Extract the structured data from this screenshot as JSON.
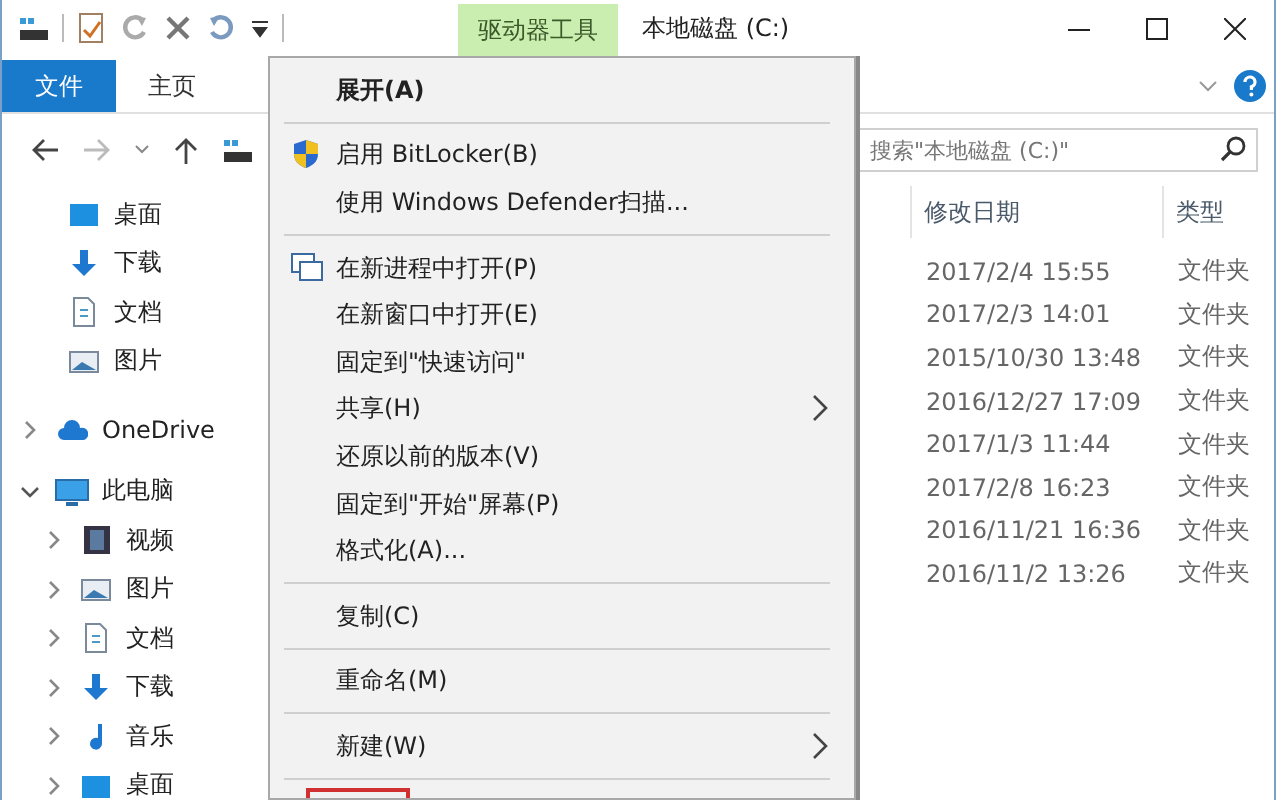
{
  "window": {
    "context_tab": "驱动器工具",
    "title": "本地磁盘 (C:)"
  },
  "ribbon": {
    "tabs": [
      {
        "label": "文件",
        "kind": "file"
      },
      {
        "label": "主页",
        "kind": "tab"
      }
    ]
  },
  "search": {
    "placeholder": "搜索\"本地磁盘 (C:)\""
  },
  "nav": {
    "items": [
      {
        "label": "桌面",
        "kind": "desktop"
      },
      {
        "label": "下载",
        "kind": "download"
      },
      {
        "label": "文档",
        "kind": "document"
      },
      {
        "label": "图片",
        "kind": "picture"
      },
      {
        "label": "OneDrive",
        "kind": "cloud",
        "expanded": false
      },
      {
        "label": "此电脑",
        "kind": "pc",
        "expanded": true,
        "children": [
          {
            "label": "视频",
            "kind": "video",
            "expanded": false
          },
          {
            "label": "图片",
            "kind": "picture",
            "expanded": false
          },
          {
            "label": "文档",
            "kind": "document",
            "expanded": false
          },
          {
            "label": "下载",
            "kind": "download",
            "expanded": false
          },
          {
            "label": "音乐",
            "kind": "music",
            "expanded": false
          },
          {
            "label": "桌面",
            "kind": "desktop",
            "expanded": false
          }
        ]
      }
    ]
  },
  "files": {
    "columns": [
      "修改日期",
      "类型"
    ],
    "rows": [
      [
        "2017/2/4 15:55",
        "文件夹"
      ],
      [
        "2017/2/3 14:01",
        "文件夹"
      ],
      [
        "2015/10/30 13:48",
        "文件夹"
      ],
      [
        "2016/12/27 17:09",
        "文件夹"
      ],
      [
        "2017/1/3 11:44",
        "文件夹"
      ],
      [
        "2017/2/8 16:23",
        "文件夹"
      ],
      [
        "2016/11/21 16:36",
        "文件夹"
      ],
      [
        "2016/11/2 13:26",
        "文件夹"
      ]
    ]
  },
  "context_menu": {
    "items": [
      {
        "kind": "item",
        "label": "展开(A)",
        "bold": true,
        "submenu": false
      },
      {
        "kind": "separator"
      },
      {
        "kind": "shield",
        "label": "启用 BitLocker(B)",
        "bold": false,
        "submenu": false
      },
      {
        "kind": "item",
        "label": "使用 Windows Defender扫描...",
        "bold": false,
        "submenu": false
      },
      {
        "kind": "separator"
      },
      {
        "kind": "window",
        "label": "在新进程中打开(P)",
        "bold": false,
        "submenu": false
      },
      {
        "kind": "item",
        "label": "在新窗口中打开(E)",
        "bold": false,
        "submenu": false
      },
      {
        "kind": "item",
        "label": "固定到\"快速访问\"",
        "bold": false,
        "submenu": false
      },
      {
        "kind": "item",
        "label": "共享(H)",
        "bold": false,
        "submenu": true
      },
      {
        "kind": "item",
        "label": "还原以前的版本(V)",
        "bold": false,
        "submenu": false
      },
      {
        "kind": "item",
        "label": "固定到\"开始\"屏幕(P)",
        "bold": false,
        "submenu": false
      },
      {
        "kind": "item",
        "label": "格式化(A)...",
        "bold": false,
        "submenu": false
      },
      {
        "kind": "separator"
      },
      {
        "kind": "item",
        "label": "复制(C)",
        "bold": false,
        "submenu": false
      },
      {
        "kind": "separator"
      },
      {
        "kind": "item",
        "label": "重命名(M)",
        "bold": false,
        "submenu": false
      },
      {
        "kind": "separator"
      },
      {
        "kind": "item",
        "label": "新建(W)",
        "bold": false,
        "submenu": true
      },
      {
        "kind": "separator"
      },
      {
        "kind": "highlight"
      }
    ]
  }
}
